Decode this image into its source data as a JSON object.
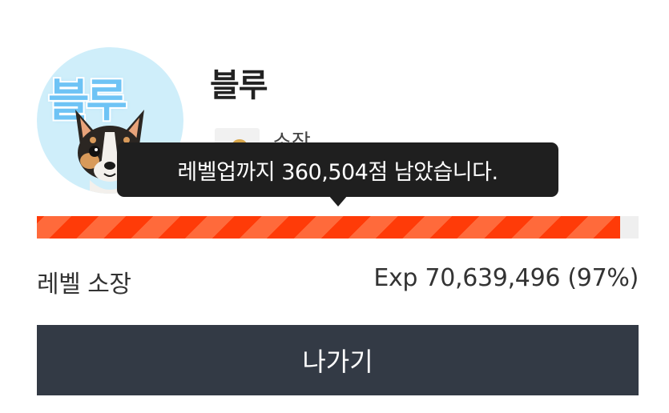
{
  "profile": {
    "avatar_text": "블루",
    "avatar_icon": "chihuahua-dog",
    "name": "블루",
    "badge_label": "소장"
  },
  "tooltip": {
    "text": "레벨업까지 360,504점 남았습니다."
  },
  "progress": {
    "percent": 97,
    "fill_color": "#ff3f0f"
  },
  "level": {
    "label": "레벨 소장",
    "exp_text": "Exp 70,639,496 (97%)"
  },
  "actions": {
    "exit_label": "나가기",
    "exit_color": "#333a45"
  }
}
